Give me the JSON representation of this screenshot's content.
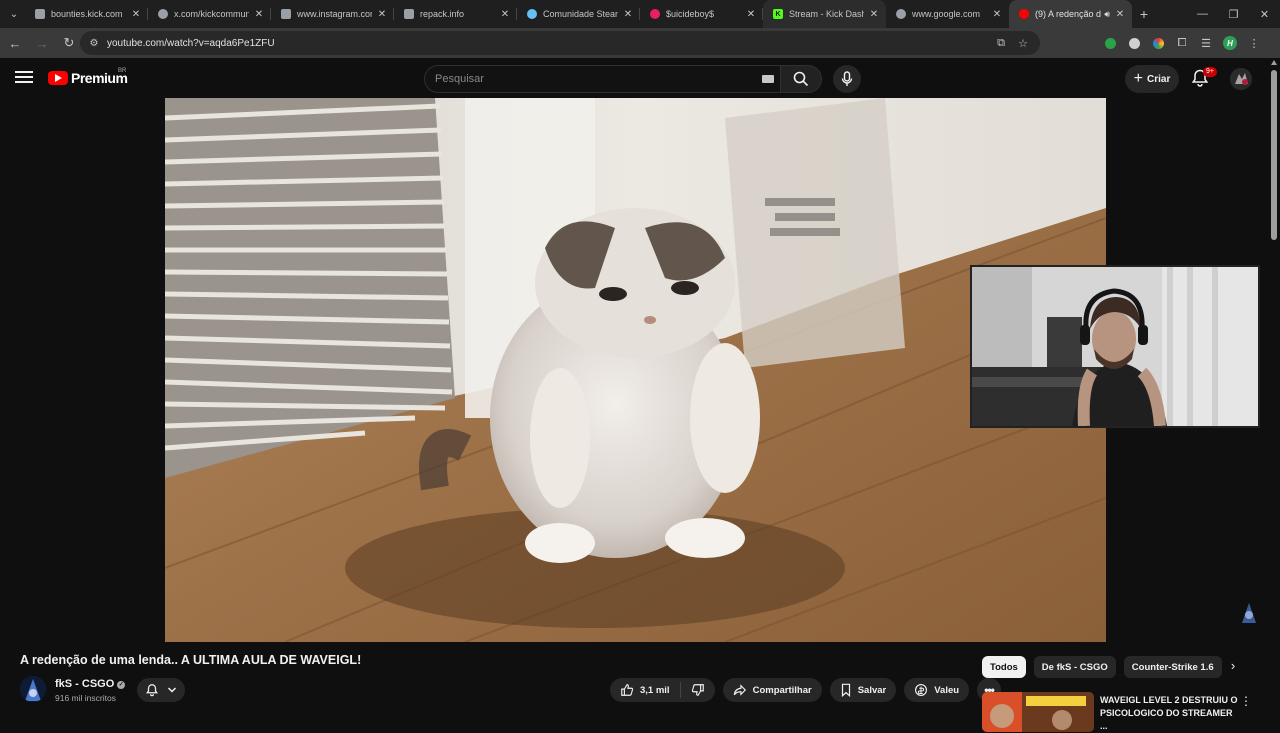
{
  "browser": {
    "tabs": [
      {
        "title": "bounties.kick.com",
        "favicon_color": "#9aa0a6"
      },
      {
        "title": "x.com/kickcommunity",
        "favicon_color": "#9aa0a6"
      },
      {
        "title": "www.instagram.com",
        "favicon_color": "#9aa0a6"
      },
      {
        "title": "repack.info",
        "favicon_color": "#9aa0a6"
      },
      {
        "title": "Comunidade Steam",
        "favicon_color": "#66c0f4"
      },
      {
        "title": "$uicideboy$",
        "favicon_color": "#e91e63"
      },
      {
        "title": "Stream - Kick Dashb",
        "favicon_color": "#53fc18",
        "favicon_letter": "K"
      },
      {
        "title": "www.google.com",
        "favicon_color": "#9aa0a6"
      },
      {
        "title": "(9) A redenção d",
        "favicon_color": "#ff0000"
      }
    ],
    "url": "youtube.com/watch?v=aqda6Pe1ZFU"
  },
  "youtube": {
    "logo_text": "Premium",
    "country_code": "BR",
    "search_placeholder": "Pesquisar",
    "create_label": "Criar",
    "notification_badge": "9+",
    "video": {
      "title": "A redenção de uma lenda.. A ULTIMA AULA DE WAVEIGL!",
      "channel": "fkS - CSGO",
      "subscribers": "916 mil inscritos",
      "likes": "3,1 mil",
      "share_label": "Compartilhar",
      "save_label": "Salvar",
      "thanks_label": "Valeu"
    },
    "chips": [
      "Todos",
      "De fkS - CSGO",
      "Counter-Strike 1.6"
    ],
    "recommendation": {
      "title": "WAVEIGL LEVEL 2 DESTRUIU O PSICOLOGICO DO STREAMER ..."
    }
  },
  "colors": {
    "brand": "#ff0000",
    "background": "#0f0f0f",
    "chip_selected": "#f1f1f1"
  }
}
